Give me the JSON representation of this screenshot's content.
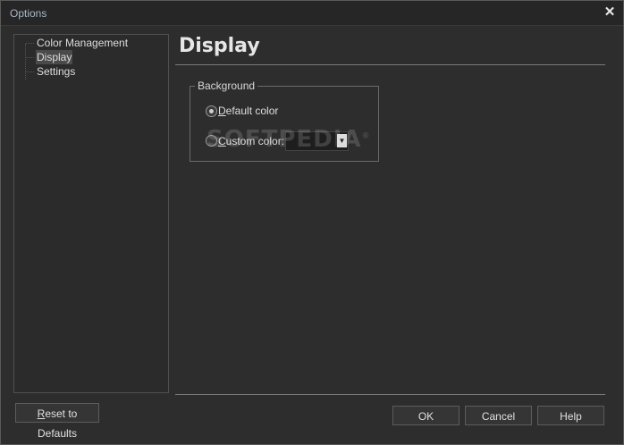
{
  "window": {
    "title": "Options"
  },
  "tree": {
    "items": [
      {
        "label": "Color Management",
        "selected": false
      },
      {
        "label": "Display",
        "selected": true
      },
      {
        "label": "Settings",
        "selected": false
      }
    ]
  },
  "panel": {
    "heading": "Display",
    "group_label": "Background",
    "options": {
      "default_color": "Default color",
      "custom_color": "Custom color:"
    },
    "selected_option": "default_color"
  },
  "buttons": {
    "reset": "Reset to Defaults",
    "ok": "OK",
    "cancel": "Cancel",
    "help": "Help"
  },
  "watermark": "SOFTPEDIA",
  "colors": {
    "background": "#2d2d2d",
    "title_text": "#a8b8c8",
    "selection": "#4a4a4a"
  }
}
